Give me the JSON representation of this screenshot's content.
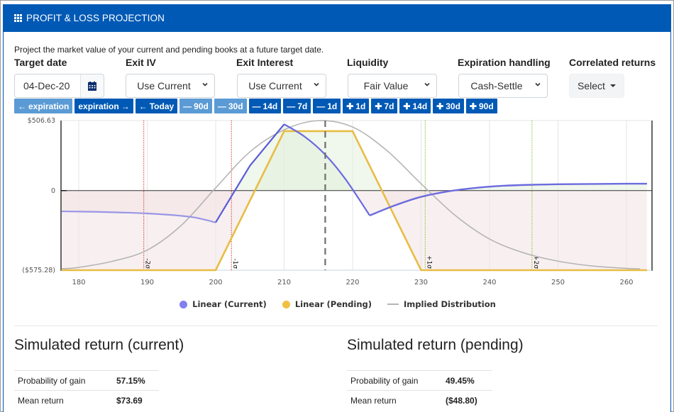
{
  "header": {
    "title": "PROFIT & LOSS PROJECTION",
    "icon": "grid-icon"
  },
  "description": "Project the market value of your current and pending books at a future target date.",
  "fields": {
    "target_date": {
      "label": "Target date",
      "value": "04-Dec-20",
      "icon": "calendar-icon"
    },
    "exit_iv": {
      "label": "Exit IV",
      "value": "Use Current"
    },
    "exit_interest": {
      "label": "Exit Interest",
      "value": "Use Current"
    },
    "liquidity": {
      "label": "Liquidity",
      "value": "Fair Value"
    },
    "expiration_handling": {
      "label": "Expiration handling",
      "value": "Cash-Settle"
    },
    "correlated_returns": {
      "label": "Correlated returns",
      "value": "Select"
    }
  },
  "date_buttons": [
    {
      "label": "expiration",
      "icon": "arrow-left",
      "style": "light"
    },
    {
      "label": "expiration",
      "icon": "arrow-right",
      "style": "dark"
    },
    {
      "label": "Today",
      "icon": "arrow-left",
      "style": "dark"
    },
    {
      "label": "90d",
      "icon": "minus",
      "style": "light"
    },
    {
      "label": "30d",
      "icon": "minus",
      "style": "light"
    },
    {
      "label": "14d",
      "icon": "minus",
      "style": "dark"
    },
    {
      "label": "7d",
      "icon": "minus",
      "style": "dark"
    },
    {
      "label": "1d",
      "icon": "minus",
      "style": "dark"
    },
    {
      "label": "1d",
      "icon": "plus",
      "style": "dark"
    },
    {
      "label": "7d",
      "icon": "plus",
      "style": "dark"
    },
    {
      "label": "14d",
      "icon": "plus",
      "style": "dark"
    },
    {
      "label": "30d",
      "icon": "plus",
      "style": "dark"
    },
    {
      "label": "90d",
      "icon": "plus",
      "style": "dark"
    }
  ],
  "chart_data": {
    "type": "line",
    "title": "",
    "xlabel": "",
    "ylabel": "",
    "xlim": [
      177.5,
      263
    ],
    "ylim": [
      -575.28,
      506.63
    ],
    "x_ticks": [
      180,
      190,
      200,
      210,
      220,
      230,
      240,
      250,
      260
    ],
    "y_tick_labels": [
      {
        "value": 506.63,
        "label": "$506.63"
      },
      {
        "value": 0,
        "label": "0"
      },
      {
        "value": -575.28,
        "label": "($575.28)"
      }
    ],
    "grid": true,
    "legend_position": "bottom",
    "current_price": 216,
    "sigma_lines": [
      {
        "x": 189.5,
        "label": "-2σ",
        "color": "#cc0000"
      },
      {
        "x": 202.3,
        "label": "-1σ",
        "color": "#cc0000"
      },
      {
        "x": 230.6,
        "label": "+1σ",
        "color": "#66aa00"
      },
      {
        "x": 246.2,
        "label": "+2σ",
        "color": "#66aa00"
      }
    ],
    "series": [
      {
        "name": "Linear (Current)",
        "color": "#6b6bdf",
        "x": [
          177.5,
          182,
          186,
          190,
          194,
          197,
          200,
          205,
          210,
          213,
          216,
          219,
          222.5,
          226,
          230,
          234,
          238,
          242,
          246,
          250,
          255,
          260,
          263
        ],
        "y": [
          -150,
          -153,
          -158,
          -165,
          -178,
          -195,
          -230,
          180,
          480,
          390,
          260,
          80,
          -180,
          -110,
          -45,
          -5,
          20,
          35,
          42,
          46,
          48,
          50,
          50
        ]
      },
      {
        "name": "Linear (Pending)",
        "color": "#e8bd45",
        "x": [
          177.5,
          200,
          210,
          220,
          230,
          263
        ],
        "y": [
          -575.28,
          -575.28,
          430,
          430,
          -575.28,
          -575.28
        ]
      },
      {
        "name": "Implied Distribution",
        "color": "#b5b5b5",
        "x": [
          177.5,
          180,
          185,
          190,
          195,
          200,
          205,
          210,
          215,
          220,
          225,
          230,
          235,
          240,
          245,
          250,
          255,
          260,
          262
        ],
        "y": [
          -565,
          -555,
          -510,
          -430,
          -250,
          20,
          280,
          440,
          506,
          460,
          290,
          50,
          -180,
          -350,
          -450,
          -510,
          -545,
          -562,
          -566
        ]
      }
    ]
  },
  "legend": [
    {
      "label": "Linear (Current)",
      "color": "#8080f0",
      "marker": "dot"
    },
    {
      "label": "Linear (Pending)",
      "color": "#f0c040",
      "marker": "dot"
    },
    {
      "label": "Implied Distribution",
      "color": "#b5b5b5",
      "marker": "line"
    }
  ],
  "simulated_current": {
    "title": "Simulated return (current)",
    "rows": [
      {
        "label": "Probability of gain",
        "value": "57.15%"
      },
      {
        "label": "Mean return",
        "value": "$73.69"
      }
    ]
  },
  "simulated_pending": {
    "title": "Simulated return (pending)",
    "rows": [
      {
        "label": "Probability of gain",
        "value": "49.45%"
      },
      {
        "label": "Mean return",
        "value": "($48.80)"
      }
    ]
  }
}
